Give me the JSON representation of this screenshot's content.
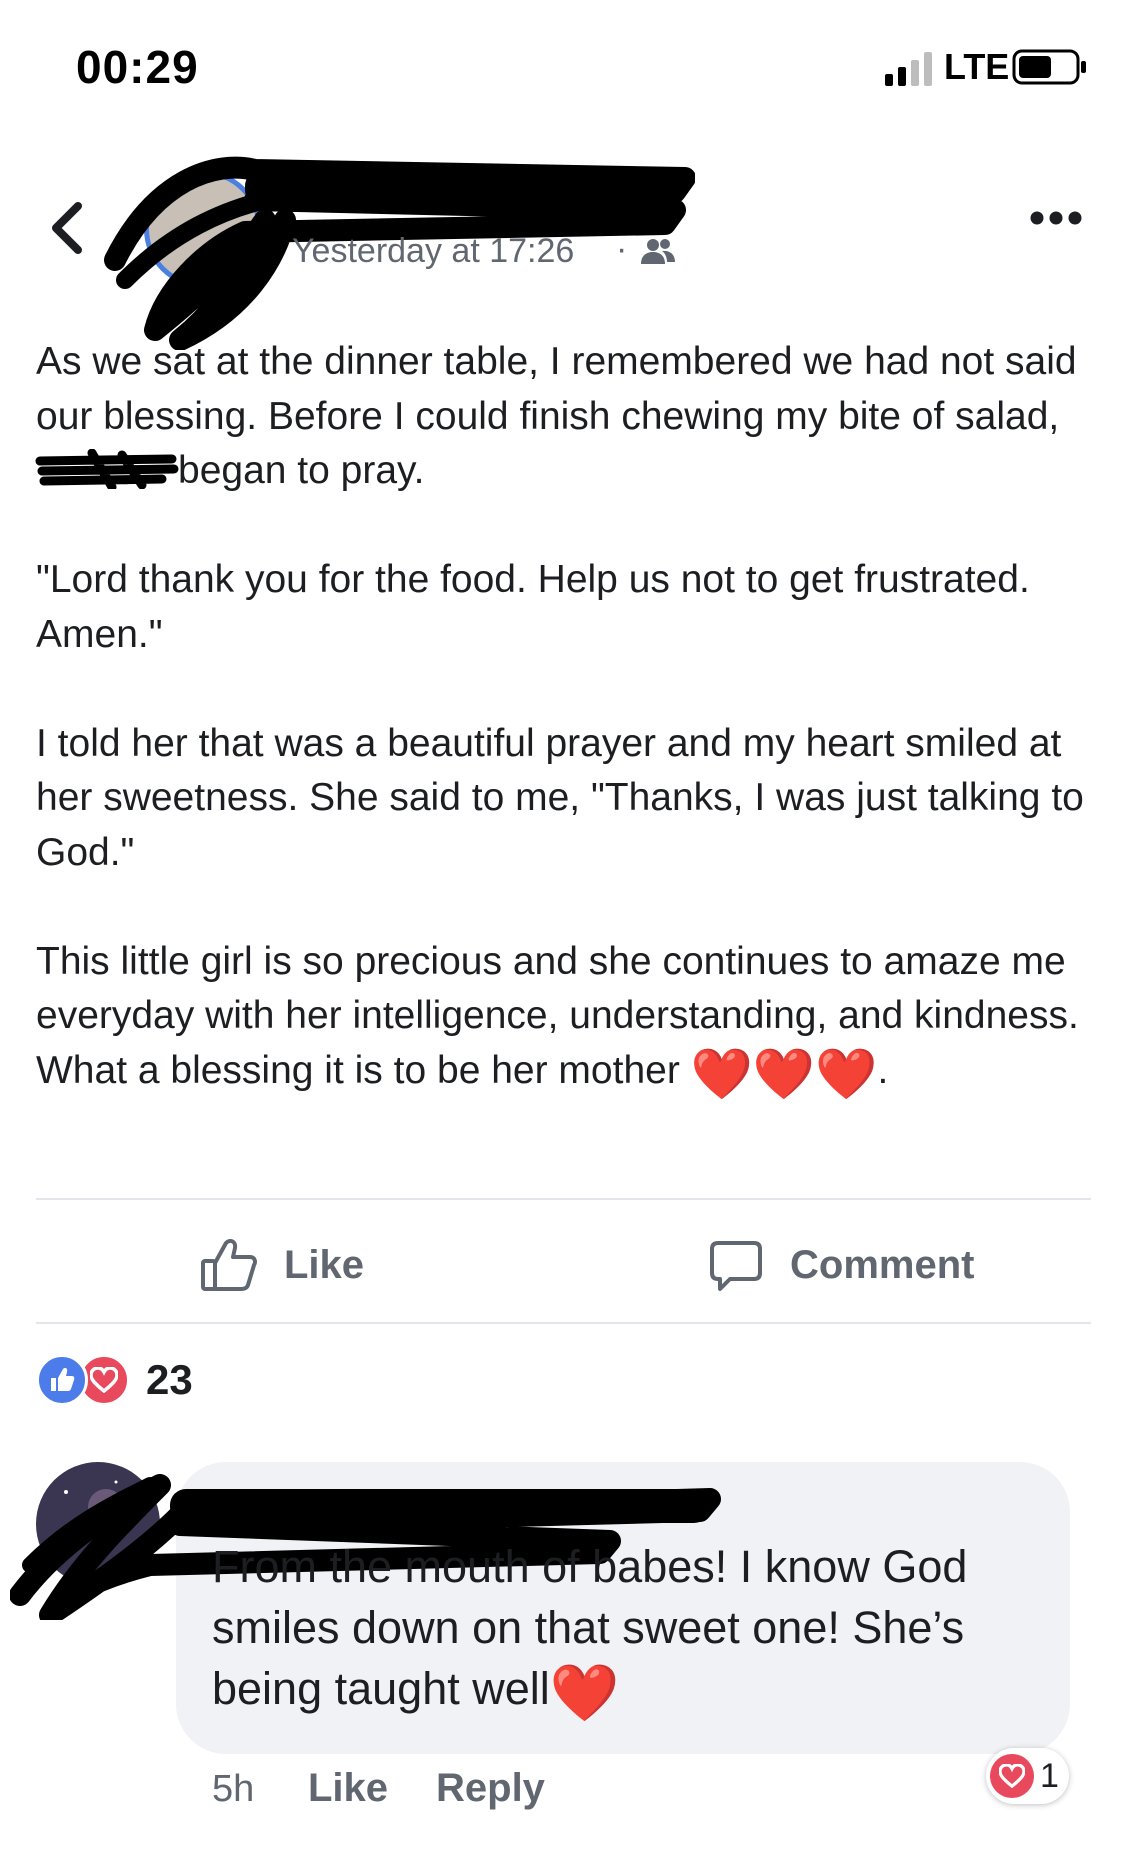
{
  "status_bar": {
    "time": "00:29",
    "carrier": "LTE"
  },
  "post": {
    "timestamp": "Yesterday at 17:26",
    "separator": "·",
    "audience_icon": "friends-icon",
    "body": {
      "p1_before": "As we sat at the dinner table, I remembered we had not said our blessing. Before I could finish chewing my bite of salad,",
      "p1_after": "began to pray.",
      "p2": "\"Lord thank you for the food. Help us not to get frustrated. Amen.\"",
      "p3": "I told her that was a beautiful prayer and my heart smiled at her sweetness. She said to me, \"Thanks, I was just talking to God.\"",
      "p4": "This little girl is so precious and she continues to amaze me everyday with her intelligence, understanding, and kindness. What a blessing it is to be her mother",
      "p4_emoji": "❤️❤️❤️",
      "p4_end": "."
    },
    "actions": {
      "like_label": "Like",
      "comment_label": "Comment"
    },
    "reactions": {
      "icons": [
        "like-reaction-icon",
        "love-reaction-icon"
      ],
      "count": "23"
    }
  },
  "comment": {
    "text": "From the mouth of babes! I know God smiles down on that sweet one! She’s being taught well",
    "text_emoji": "❤️",
    "time": "5h",
    "like_label": "Like",
    "reply_label": "Reply",
    "reaction_count": "1"
  },
  "colors": {
    "accent_blue": "#4b7cea",
    "love_red": "#e8495c",
    "secondary_text": "#606770",
    "bubble_bg": "#f0f2f5"
  }
}
